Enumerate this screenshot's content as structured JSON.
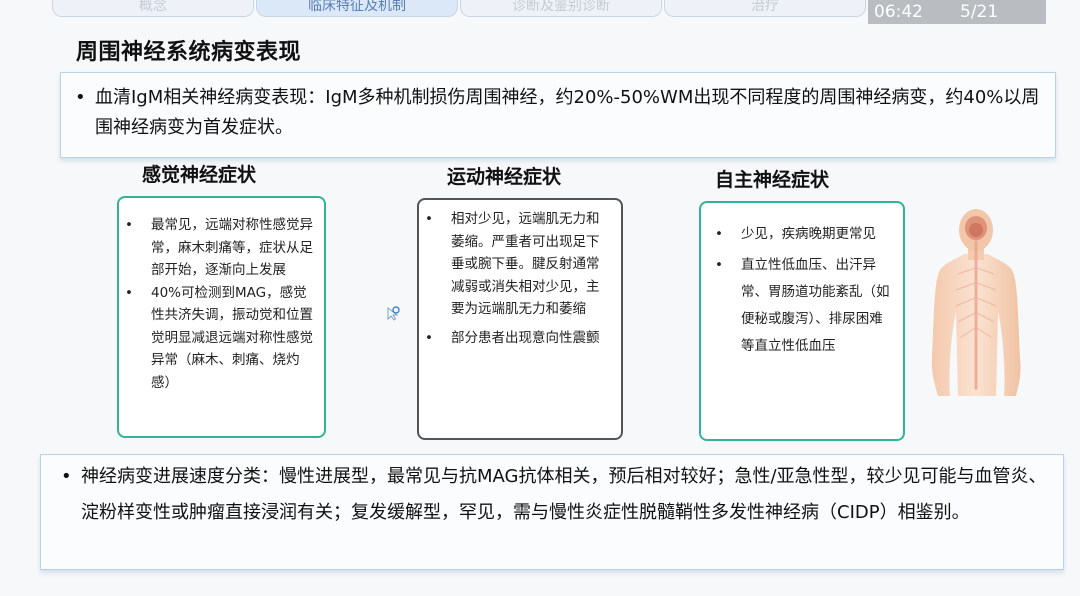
{
  "tabs": [
    "概念",
    "临床特征及机制",
    "诊断及鉴别诊断",
    "治疗"
  ],
  "hud": {
    "time": "06:42",
    "page": "5/21"
  },
  "title": "周围神经系统病变表现",
  "intro": "血清IgM相关神经病变表现：IgM多种机制损伤周围神经，约20%-50%WM出现不同程度的周围神经病变，约40%以周围神经病变为首发症状。",
  "columns": [
    {
      "title": "感觉神经症状",
      "items": [
        "最常见，远端对称性感觉异常，麻木刺痛等，症状从足部开始，逐渐向上发展",
        "40%可检测到MAG，感觉性共济失调，振动觉和位置觉明显减退远端对称性感觉异常（麻木、刺痛、烧灼感）"
      ]
    },
    {
      "title": "运动神经症状",
      "items": [
        "相对少见，远端肌无力和萎缩。严重者可出现足下垂或腕下垂。腱反射通常减弱或消失相对少见，主要为远端肌无力和萎缩",
        "部分患者出现意向性震颤"
      ]
    },
    {
      "title": "自主神经症状",
      "items": [
        "少见，疾病晚期更常见",
        "直立性低血压、出汗异常、胃肠道功能紊乱（如便秘或腹泻）、排尿困难等直立性低血压"
      ]
    }
  ],
  "summary": "神经病变进展速度分类：慢性进展型，最常见与抗MAG抗体相关，预后相对较好；急性/亚急性型，较少见可能与血管炎、淀粉样变性或肿瘤直接浸润有关；复发缓解型，罕见，需与慢性炎症性脱髓鞘性多发性神经病（CIDP）相鉴别。",
  "bullet": "•",
  "colors": {
    "green_border": "#2fb596",
    "box_border": "#b5d4ea"
  }
}
